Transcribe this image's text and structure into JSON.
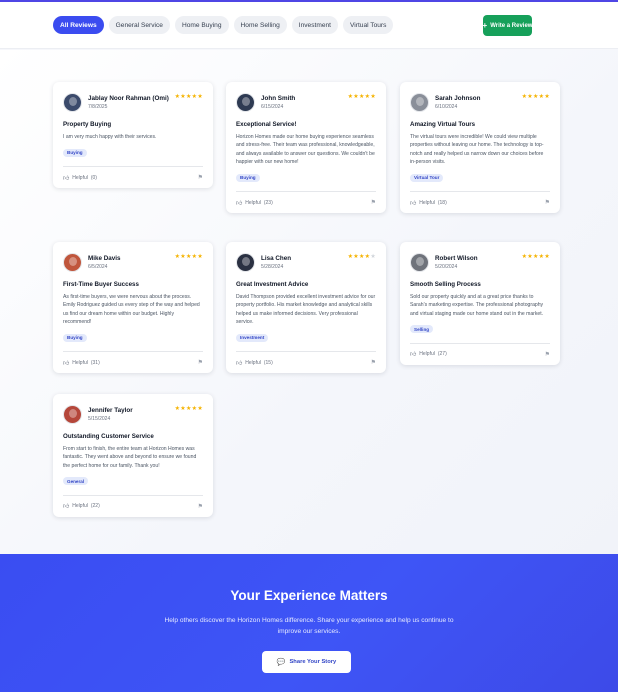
{
  "filters": [
    "All Reviews",
    "General Service",
    "Home Buying",
    "Home Selling",
    "Investment",
    "Virtual Tours"
  ],
  "active_filter": "All Reviews",
  "write_review": "Write a Review",
  "helpful_label": "Helpful",
  "reviews": [
    {
      "name": "Jablay Noor Rahman (Omi)",
      "date": "7/8/2025",
      "rating": 5,
      "title": "Property Buying",
      "text": "I am very much happy with their services.",
      "tag": "Buying",
      "helpful": "(0)",
      "avatar_color": "#3b4a6b"
    },
    {
      "name": "John Smith",
      "date": "6/15/2024",
      "rating": 5,
      "title": "Exceptional Service!",
      "text": "Horizon Homes made our home buying experience seamless and stress-free. Their team was professional, knowledgeable, and always available to answer our questions. We couldn't be happier with our new home!",
      "tag": "Buying",
      "helpful": "(23)",
      "avatar_color": "#2e3a52"
    },
    {
      "name": "Sarah Johnson",
      "date": "6/10/2024",
      "rating": 5,
      "title": "Amazing Virtual Tours",
      "text": "The virtual tours were incredible! We could view multiple properties without leaving our home. The technology is top-notch and really helped us narrow down our choices before in-person visits.",
      "tag": "Virtual Tour",
      "helpful": "(18)",
      "avatar_color": "#8a8f99"
    },
    {
      "name": "Mike Davis",
      "date": "6/5/2024",
      "rating": 5,
      "title": "First-Time Buyer Success",
      "text": "As first-time buyers, we were nervous about the process. Emily Rodriguez guided us every step of the way and helped us find our dream home within our budget. Highly recommend!",
      "tag": "Buying",
      "helpful": "(31)",
      "avatar_color": "#c0563c"
    },
    {
      "name": "Lisa Chen",
      "date": "5/28/2024",
      "rating": 4,
      "title": "Great Investment Advice",
      "text": "David Thompson provided excellent investment advice for our property portfolio. His market knowledge and analytical skills helped us make informed decisions. Very professional service.",
      "tag": "Investment",
      "helpful": "(15)",
      "avatar_color": "#2b3142"
    },
    {
      "name": "Robert Wilson",
      "date": "5/20/2024",
      "rating": 5,
      "title": "Smooth Selling Process",
      "text": "Sold our property quickly and at a great price thanks to Sarah's marketing expertise. The professional photography and virtual staging made our home stand out in the market.",
      "tag": "Selling",
      "helpful": "(27)",
      "avatar_color": "#6f737b"
    },
    {
      "name": "Jennifer Taylor",
      "date": "5/15/2024",
      "rating": 5,
      "title": "Outstanding Customer Service",
      "text": "From start to finish, the entire team at Horizon Homes was fantastic. They went above and beyond to ensure we found the perfect home for our family. Thank you!",
      "tag": "General",
      "helpful": "(22)",
      "avatar_color": "#b5473a"
    }
  ],
  "cta": {
    "title": "Your Experience Matters",
    "text": "Help others discover the Horizon Homes difference. Share your experience and help us continue to improve our services.",
    "button": "Share Your Story"
  },
  "colors": {
    "accent": "#3b4cf0",
    "write_button": "#16a05a",
    "star": "#f5b301",
    "cta_bg": "#3a4df2"
  },
  "icons": {
    "plus": "plus-icon",
    "thumb": "thumbs-up-icon",
    "flag": "flag-icon",
    "chat": "chat-icon",
    "star": "star-icon"
  }
}
